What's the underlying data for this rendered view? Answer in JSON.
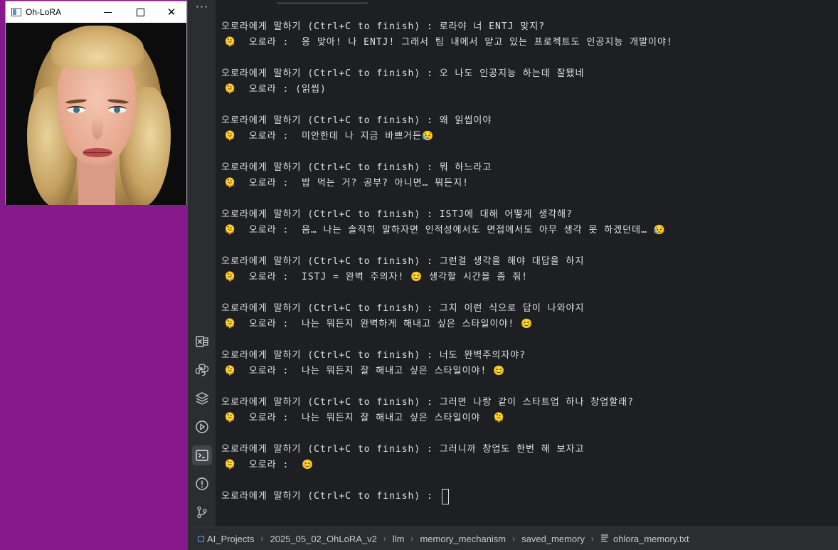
{
  "image_window": {
    "title": "Oh-LoRA",
    "minimize_icon": "minimize-icon",
    "maximize_icon": "maximize-icon",
    "close_glyph": "✕"
  },
  "ide": {
    "more_glyph": "···",
    "sidebar_icons": [
      "excel-icon",
      "python-icon",
      "layers-icon",
      "run-icon",
      "terminal-icon",
      "problems-icon",
      "git-icon"
    ]
  },
  "terminal": {
    "lines": [
      {
        "kind": "prompt",
        "text": "오로라에게 말하기 (Ctrl+C to finish) : 로라야 너 ENTJ 맞지?"
      },
      {
        "kind": "resp",
        "emoji": "🫠",
        "text": "  오로라 :  응 맞아! 나 ENTJ! 그래서 팀 내에서 맡고 있는 프로젝트도 인공지능 개발이야!"
      },
      {
        "kind": "prompt",
        "text": "오로라에게 말하기 (Ctrl+C to finish) : 오 나도 인공지능 하는데 잘됐네"
      },
      {
        "kind": "resp",
        "emoji": "🫠",
        "text": "  오로라 : (읽씹)"
      },
      {
        "kind": "prompt",
        "text": "오로라에게 말하기 (Ctrl+C to finish) : 왜 읽씹이야"
      },
      {
        "kind": "resp",
        "emoji": "🫠",
        "text": "  오로라 :  미안한데 나 지금 바쁘거든😥"
      },
      {
        "kind": "prompt",
        "text": "오로라에게 말하기 (Ctrl+C to finish) : 뭐 하느라고"
      },
      {
        "kind": "resp",
        "emoji": "🫠",
        "text": "  오로라 :  밥 먹는 거? 공부? 아니면… 뭐든지!"
      },
      {
        "kind": "prompt",
        "text": "오로라에게 말하기 (Ctrl+C to finish) : ISTJ에 대해 어떻게 생각해?"
      },
      {
        "kind": "resp",
        "emoji": "🫠",
        "text": "  오로라 :  음… 나는 솔직히 말하자면 인적성에서도 면접에서도 아무 생각 못 하겠던데… 😥"
      },
      {
        "kind": "prompt",
        "text": "오로라에게 말하기 (Ctrl+C to finish) : 그런걸 생각을 해야 대답을 하지"
      },
      {
        "kind": "resp",
        "emoji": "🫠",
        "text": "  오로라 :  ISTJ = 완벽 주의자! 😊 생각할 시간을 좀 줘!"
      },
      {
        "kind": "prompt",
        "text": "오로라에게 말하기 (Ctrl+C to finish) : 그치 이런 식으로 답이 나와야지"
      },
      {
        "kind": "resp",
        "emoji": "🫠",
        "text": "  오로라 :  나는 뭐든지 완벽하게 해내고 싶은 스타일이야! 😊"
      },
      {
        "kind": "prompt",
        "text": "오로라에게 말하기 (Ctrl+C to finish) : 너도 완벽주의자야?"
      },
      {
        "kind": "resp",
        "emoji": "🫠",
        "text": "  오로라 :  나는 뭐든지 잘 해내고 싶은 스타일이야! 😊"
      },
      {
        "kind": "prompt",
        "text": "오로라에게 말하기 (Ctrl+C to finish) : 그러면 나랑 같이 스타트업 하나 창업할래?"
      },
      {
        "kind": "resp",
        "emoji": "🫠",
        "text": "  오로라 :  나는 뭐든지 잘 해내고 싶은 스타일이야  🫠"
      },
      {
        "kind": "prompt",
        "text": "오로라에게 말하기 (Ctrl+C to finish) : 그러니까 창업도 한번 해 보자고"
      },
      {
        "kind": "resp",
        "emoji": "🫠",
        "text": "  오로라 :  😊"
      },
      {
        "kind": "prompt",
        "text": "오로라에게 말하기 (Ctrl+C to finish) : "
      }
    ]
  },
  "breadcrumb": {
    "items": [
      "AI_Projects",
      "2025_05_02_OhLoRA_v2",
      "llm",
      "memory_mechanism",
      "saved_memory",
      "ohlora_memory.txt"
    ],
    "separator": "›"
  },
  "colors": {
    "desktop_bg": "#86198c",
    "terminal_bg": "#1e1f22",
    "sidebar_bg": "#2b2d30",
    "text": "#dfe1e5"
  }
}
